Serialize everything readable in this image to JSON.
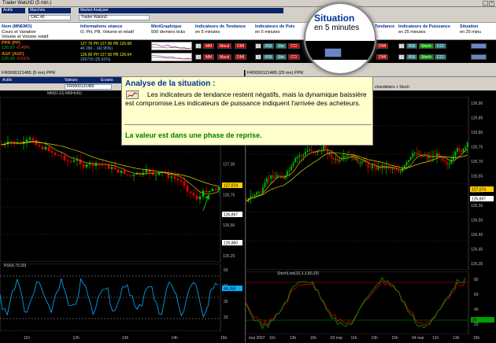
{
  "window": {
    "title": "Trader WatchD (5 min.)"
  },
  "toolbar": {
    "actifs_label": "Actifs",
    "marches_label": "Marchés",
    "marche_value": "CAC 40",
    "market_analyser_label": "Market Analyser",
    "market_analyser_value": "Trader WatchD"
  },
  "columns": {
    "nom": {
      "title": "Nom (MNEMO)",
      "sub1": "Cours et Variation",
      "sub2": "Volume et Volume relatif"
    },
    "infos": {
      "title": "Informations séance",
      "sub1": "O, PH, PB, Volume et relatif"
    },
    "minigraph": {
      "title": "MiniGraphique",
      "sub1": "500 derniers ticks"
    },
    "tendance": {
      "title": "Indicateurs de Tendance",
      "sub1": "en 5 minutes"
    },
    "puissance": {
      "title": "Indicateurs de Puis",
      "sub1": "en 5 minutes"
    },
    "tendance25": {
      "title": "Tendance",
      "sub1": ""
    },
    "puissance25": {
      "title": "Indicateurs de Puissance",
      "sub1": "en 25 minutes"
    },
    "situation25": {
      "title": "Situation",
      "sub1": "en 25 minu"
    }
  },
  "rows": [
    {
      "name": "PPR (PP)",
      "price": "126.87",
      "change": "-0.49%",
      "volume": "46 260 ↓",
      "vol_rel": "(42.95%)",
      "info_line": "127.76 PH 127.95 PB 126.68",
      "indicators_tendance": [
        "MM",
        "Macd",
        "DMI"
      ],
      "indicators_puissance": [
        "RSI",
        "Sto",
        "CCI"
      ],
      "indicators_25": [
        "DMI"
      ],
      "indicators_p25": [
        "RSI",
        "Stoch",
        "CCI"
      ]
    },
    {
      "name": "AGF (AGF)",
      "price": "126.90",
      "change": "-0.61%",
      "volume": "226715",
      "vol_rel": "(25.61%)",
      "info_line": "126.90 PH 127.50 PB 126.64",
      "indicators_tendance": [
        "MM",
        "Macd",
        "DMI"
      ],
      "indicators_puissance": [
        "RSI",
        "Sto",
        "CCI"
      ],
      "indicators_25": [
        "DMI"
      ],
      "indicators_p25": [
        "RSI",
        "Stoch",
        "CCI"
      ]
    }
  ],
  "situation_bubble": {
    "title": "Situation",
    "subtitle": "en 5 minutes"
  },
  "left_panel": {
    "bar_title": "FR0000121485 (5 mn) PPR",
    "tab_actifs": "Actifs",
    "tab_valeurs": "Valeurs",
    "tab_ecrans": "Ecrans",
    "sub_value": "FR0000121485",
    "legend": "MM(0-10)    MMH(40)",
    "y_ticks": [
      "127,50",
      "127,25",
      "127,00",
      "126,75",
      "126,50",
      "126,25"
    ],
    "price_tags": {
      "ma": "127,074",
      "last": "126,897",
      "low": "126,860"
    },
    "indicator_label": "RSI(6,70,30)",
    "indicator_ticks": [
      "65",
      "50",
      "35",
      "25"
    ],
    "indicator_tag": "44,359",
    "x_ticks": [
      "11h",
      "12h",
      "13h",
      "14h",
      "15h"
    ]
  },
  "right_panel": {
    "bar_title": "FR0000121485 (25 mn) PPR",
    "chandeliers_label": "chandeliers + Stoch",
    "y_ticks": [
      "126,90",
      "126,85",
      "126,80",
      "126,75",
      "126,70",
      "126,65",
      "126,60",
      "126,55",
      "126,50",
      "126,45",
      "126,40",
      "126,35"
    ],
    "price_tags": {
      "ma": "127,074",
      "last": "126,897"
    },
    "indicator_label": "StochLow(10,3,3,80,20)",
    "indicator_ticks": [
      "80",
      "60",
      "40",
      "20"
    ],
    "indicator_tag": "20",
    "x_ticks": [
      "mai 2007",
      "11h",
      "13h",
      "15h",
      "03 mai",
      "11h",
      "13h",
      "15h",
      "04 mai",
      "11h",
      "13h",
      "15h"
    ]
  },
  "analysis_popup": {
    "title": "Analyse de la situation :",
    "text": "Les indicateurs de tendance restent négatifs, mais la dynamique baissière est compromise.Les indicateurs de puissance indiquent l'arrivée des acheteurs.",
    "conclusion": "La valeur est dans une phase de reprise."
  },
  "colors": {
    "bull": "#00c000",
    "bear": "#e00000",
    "ma_fast": "#c8a000",
    "ma_slow": "#ffff00",
    "rsi": "#00b0ff",
    "stoch_k": "#e00000",
    "stoch_d": "#00a000"
  }
}
